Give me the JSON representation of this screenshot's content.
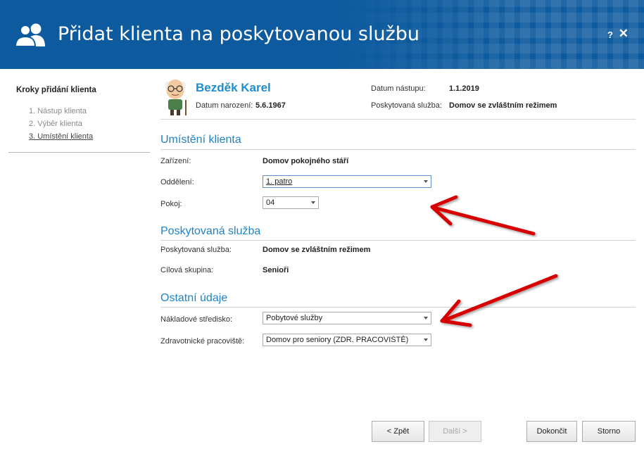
{
  "header": {
    "title": "Přidat klienta na poskytovanou službu",
    "help": "?",
    "close": "✕"
  },
  "sidebar": {
    "title": "Kroky přidání klienta",
    "steps": [
      "1. Nástup klienta",
      "2. Výběr klienta",
      "3. Umístění klienta"
    ]
  },
  "client": {
    "name": "Bezděk Karel",
    "birth_label": "Datum narození:",
    "birth_value": "5.6.1967",
    "start_label": "Datum nástupu:",
    "start_value": "1.1.2019",
    "service_label": "Poskytovaná služba:",
    "service_value": "Domov se zvláštním režimem"
  },
  "placement": {
    "title": "Umístění klienta",
    "facility_label": "Zařízení:",
    "facility_value": "Domov pokojného stáří",
    "department_label": "Oddělení:",
    "department_value": "1. patro",
    "room_label": "Pokoj:",
    "room_value": "04"
  },
  "service": {
    "title": "Poskytovaná služba",
    "service_label": "Poskytovaná služba:",
    "service_value": "Domov se zvláštním režimem",
    "target_label": "Cílová skupina:",
    "target_value": "Senioři"
  },
  "other": {
    "title": "Ostatní údaje",
    "cost_label": "Nákladové středisko:",
    "cost_value": "Pobytové služby",
    "health_label": "Zdravotnické pracoviště:",
    "health_value": "Domov pro seniory (ZDR. PRACOVIŠTĚ)"
  },
  "buttons": {
    "back": "< Zpět",
    "next": "Další >",
    "finish": "Dokončit",
    "cancel": "Storno"
  },
  "colors": {
    "header_bg": "#0d5a9e",
    "accent": "#1f84c6",
    "annotation": "#d60000"
  }
}
